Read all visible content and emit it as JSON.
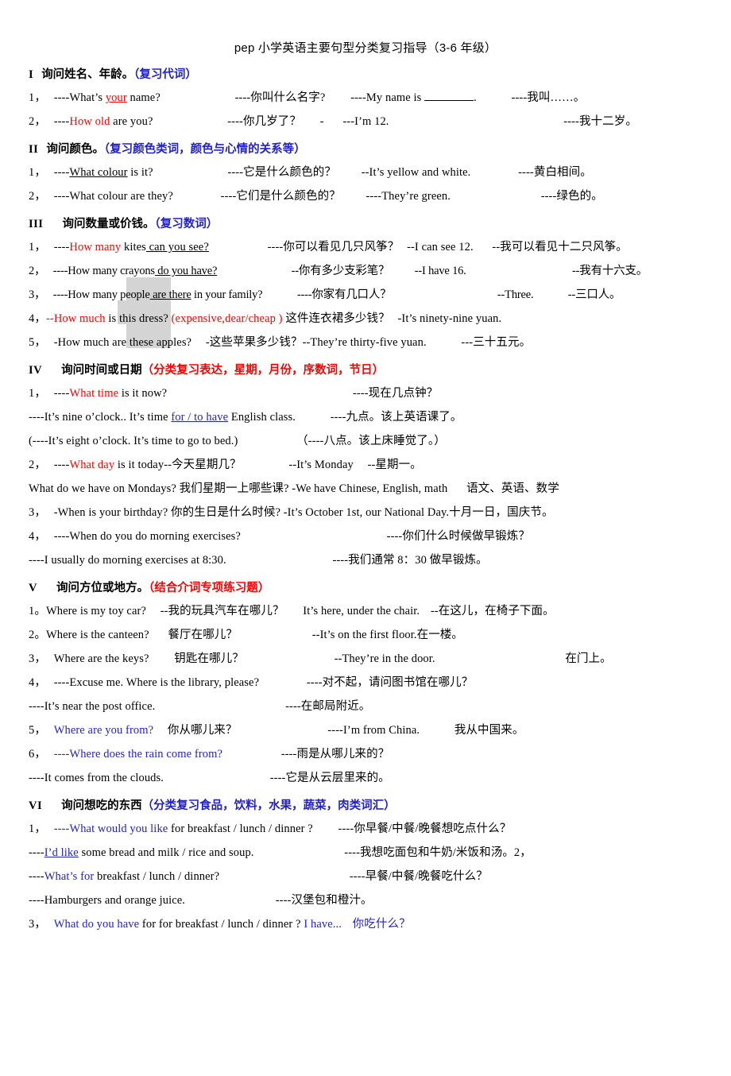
{
  "document": {
    "title": "pep 小学英语主要句型分类复习指导（3-6 年级）"
  },
  "sections": [
    {
      "num": "I",
      "title": "询问姓名、年龄。",
      "note": "（复习代词）",
      "note_color": "#2222cc",
      "lines": [
        {
          "index": "1，",
          "q_en_a": "----What’s ",
          "q_key": "your",
          "q_en_b": " name?",
          "q_zh": "----你叫什么名字?",
          "a_en": "----My name is",
          "a_blank": true,
          "a_en_tail": ".",
          "a_zh": "----我叫……。"
        },
        {
          "index": "2，",
          "q_en_a": "----",
          "q_key": "How old",
          "q_en_b": " are you?",
          "q_zh": "----你几岁了？",
          "dash": "-",
          "a_en": "---I’m 12.",
          "a_zh": "----我十二岁。"
        }
      ]
    },
    {
      "num": "II",
      "title": "询问颜色。",
      "note": "（复习颜色类词，颜色与心情的关系等）",
      "note_color": "#2222cc",
      "lines": [
        {
          "index": "1，",
          "q_en_a": "----",
          "q_key": "What colour",
          "q_en_b": " is it?",
          "q_zh": "----它是什么颜色的？",
          "a_en": "--It’s yellow and white.",
          "a_zh": "----黄白相间。"
        },
        {
          "index": "2，",
          "q_en_a": "----What colour are they?",
          "q_zh": "----它们是什么颜色的？",
          "a_en": "----They’re green.",
          "a_zh": "----绿色的。"
        }
      ]
    },
    {
      "num": "III",
      "title": "询问数量或价钱。",
      "note": "（复习数词）",
      "note_color": "#2222cc",
      "lines": [
        {
          "index": "1，",
          "q_en_a": "----",
          "q_key_red": "How many",
          "q_hl": " kites",
          "q_u": " can you see?",
          "q_zh": "----你可以看见几只风筝？",
          "a_en": "--I can see 12.",
          "a_zh": "--我可以看见十二只风筝。"
        },
        {
          "index": "2，",
          "q_en_a": "----How many",
          "q_hl": " crayons",
          "q_u": " do you have?",
          "q_zh": "--你有多少支彩笔？",
          "a_en": "--I have 16.",
          "a_zh": "--我有十六支。"
        },
        {
          "index": "3，",
          "q_en_a": "----How many",
          "q_hl": " people",
          "q_u": " are there",
          "q_en_b": " in your family?",
          "q_zh": "----你家有几口人？",
          "a_en": "--Three.",
          "a_zh": "--三口人。"
        },
        {
          "index": "4，",
          "q_en_a": "--",
          "q_key_red": "How much",
          "q_en_b": " is this dress? ",
          "q_paren_red": "(expensive,dear/cheap  )",
          "q_zh": " 这件连衣裙多少钱？",
          "a_en": "-It’s ninety-nine yuan."
        },
        {
          "index": "5，",
          "q_en_a": "-How much are these apples?",
          "q_zh": "-这些苹果多少钱？",
          "a_en": "--They’re thirty-five yuan.",
          "a_zh": "---三十五元。"
        }
      ]
    },
    {
      "num": "IV",
      "title": "询问时间或日期",
      "note": "（分类复习表达，星期，月份，序数词，节日）",
      "note_color": "#ff0000",
      "lines": [
        {
          "index": "1，",
          "q_en_a": "----",
          "q_key_red": "What time",
          "q_en_b": " is it now?",
          "q_zh": "----现在几点钟？"
        },
        {
          "cont": "----It’s nine o’clock.. It’s time ",
          "cont_key_blue_u": "for / to have",
          "cont_b": " English class.",
          "cont_zh": "----九点。该上英语课了。"
        },
        {
          "cont": "(----It’s eight o’clock. It’s time to go to bed.)",
          "cont_zh": "（----八点。该上床睡觉了。）"
        },
        {
          "index": "2，",
          "q_en_a": "----",
          "q_key_red": "What day",
          "q_en_b": " is it today--今天星期几？",
          "a_en": "--It’s Monday",
          "a_zh": "--星期一。"
        },
        {
          "cont": "What do we have on Mondays? 我们星期一上哪些课? -We have Chinese, English, math",
          "cont_zh": "语文、英语、数学"
        },
        {
          "index": "3，",
          "q_en_a": "-When is your birthday?",
          "q_zh": "  你的生日是什么时候? ",
          "a_en": "-It’s October 1st, our National Day.",
          "a_zh": "十月一日，国庆节。"
        },
        {
          "index": "4，",
          "q_en_a": "----When do you do morning exercises?",
          "q_zh": "----你们什么时候做早锻炼？"
        },
        {
          "cont": "----I usually do morning exercises at 8:30.",
          "cont_zh": "----我们通常 8：30 做早锻炼。"
        }
      ]
    },
    {
      "num": "V",
      "title": "询问方位或地方。",
      "note": "（结合介词专项练习题）",
      "note_color": "#ff0000",
      "lines": [
        {
          "index": "1。",
          "q_en_a": "Where is my toy car?",
          "q_zh": "--我的玩具汽车在哪儿？",
          "a_en": "It’s here, under the chair.",
          "a_zh": "--在这儿，在椅子下面。"
        },
        {
          "index": "2。",
          "q_en_a": "Where is the canteen?",
          "q_zh": "餐厅在哪儿？",
          "a_en": "--It’s on the first floor.",
          "a_zh": "在一楼。"
        },
        {
          "index": "3，",
          "q_en_a": "Where are the keys?",
          "q_zh": "钥匙在哪儿？",
          "a_en": "--They’re in the door.",
          "a_zh": "在门上。"
        },
        {
          "index": "4，",
          "q_en_a": "----Excuse me. Where is the library, please?",
          "q_zh": "----对不起，请问图书馆在哪儿？"
        },
        {
          "cont": "----It’s near the post office.",
          "cont_zh": "----在邮局附近。"
        },
        {
          "index": "5，",
          "q_key_blue": "Where are you from?",
          "q_zh": "你从哪儿来？",
          "a_en": "----I’m from China.",
          "a_zh": "我从中国来。"
        },
        {
          "index": "6，",
          "q_en_a": "----",
          "q_key_blue": "Where does the rain come from?",
          "q_zh": "----雨是从哪儿来的？"
        },
        {
          "cont": "----It comes from the clouds.",
          "cont_zh": "----它是从云层里来的。"
        }
      ]
    },
    {
      "num": "VI",
      "title": "询问想吃的东西",
      "note": "（分类复习食品，饮料，水果，蔬菜，肉类词汇）",
      "note_color": "#2222cc",
      "lines": [
        {
          "index": "1，",
          "q_en_a": "----",
          "q_key_blue": "What would you like",
          "q_en_b": " for breakfast / lunch / dinner ?",
          "q_zh": "----你早餐/中餐/晚餐想吃点什么？"
        },
        {
          "cont": "----",
          "cont_key_blue_u": "I’d like",
          "cont_b": " some bread and milk / rice and soup.",
          "cont_zh": "----我想吃面包和牛奶/米饭和汤。2，"
        },
        {
          "cont": "----",
          "cont_key_blue": "What’s for",
          "cont_b": " breakfast / lunch / dinner?",
          "cont_zh": "----早餐/中餐/晚餐吃什么？"
        },
        {
          "cont": "----Hamburgers and orange juice.",
          "cont_zh": "----汉堡包和橙汁。"
        },
        {
          "index": "3，",
          "q_key_blue": "What do you have",
          "q_en_b": " for for breakfast / lunch / dinner ? ",
          "q_key_blue2": "I have...",
          "q_zh_blue": "你吃什么？"
        }
      ]
    }
  ],
  "colors": {
    "red": "#ff0000",
    "blue": "#2222cc",
    "highlight_gray": "#d4d4d4",
    "text": "#000000",
    "background": "#ffffff"
  }
}
